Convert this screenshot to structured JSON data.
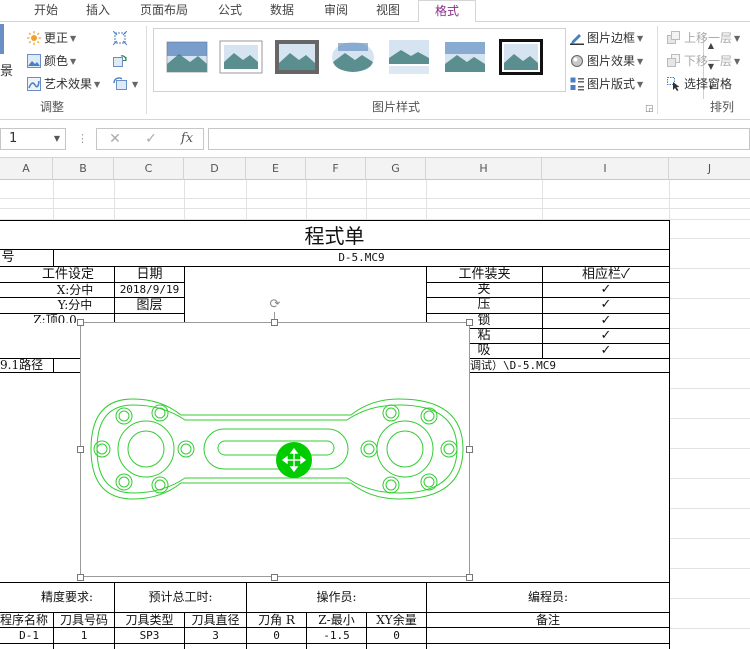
{
  "tabs": [
    "开始",
    "插入",
    "页面布局",
    "公式",
    "数据",
    "审阅",
    "视图",
    "格式"
  ],
  "active_tab": "格式",
  "ribbon": {
    "adjust": {
      "left_partial": "景",
      "corrections": "更正",
      "color": "颜色",
      "artistic": "艺术效果",
      "label": "调整"
    },
    "picture_styles": {
      "label": "图片样式",
      "border": "图片边框",
      "effects": "图片效果",
      "layout": "图片版式"
    },
    "arrange": {
      "bring_forward": "上移一层",
      "send_backward": "下移一层",
      "selection_pane": "选择窗格",
      "label": "排列"
    }
  },
  "formula_bar": {
    "name_box": "1",
    "cancel": "✕",
    "enter": "✓",
    "fx": "fx",
    "value": ""
  },
  "columns": [
    "A",
    "B",
    "C",
    "D",
    "E",
    "F",
    "G",
    "H",
    "I",
    "J"
  ],
  "sheet": {
    "title": "程式单",
    "number_label": "号",
    "number_value": "D-5.MC9",
    "work_setting": "工件设定",
    "x_setting": "X:分中",
    "y_setting": "Y:分中",
    "z_setting": "Z:顶0.0",
    "date_label": "日期",
    "date_value": "2018/9/19",
    "layer_label": "图层",
    "fixture_label": "工件装夹",
    "check_label": "相应栏✓",
    "fixture_items": [
      "夹",
      "压",
      "锁",
      "粘",
      "吸"
    ],
    "check_marks": [
      "✓",
      "✓",
      "✓",
      "✓",
      "✓"
    ],
    "path_left": "9.1路径",
    "path_right": "调试）\\D-5.MC9",
    "precision": "精度要求:",
    "est_time": "预计总工时:",
    "operator": "操作员:",
    "programmer": "编程员:",
    "table_headers": [
      "程序名称",
      "刀具号码",
      "刀具类型",
      "刀具直径",
      "刀角 R",
      "Z-最小",
      "XY余量",
      "备注"
    ],
    "rows": [
      [
        "D-1",
        "1",
        "SP3",
        "3",
        "0",
        "-1.5",
        "0",
        ""
      ]
    ]
  },
  "colors": {
    "accent_tab": "#8a2d8a",
    "drawing": "#33cc33",
    "cursor_blob": "#00cc00"
  }
}
